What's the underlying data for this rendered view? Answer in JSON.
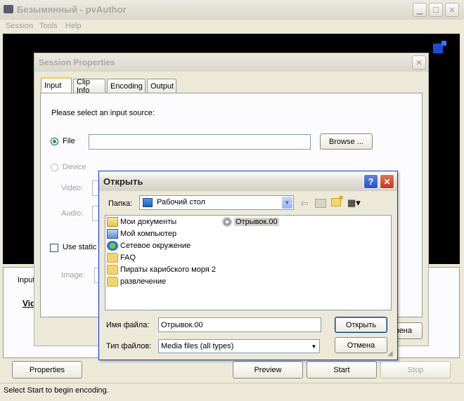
{
  "main_window": {
    "title": "Безымянный - pvAuthor",
    "menu": [
      "Session",
      "Tools",
      "Help"
    ],
    "bottom_tab_partial": "Input",
    "bottom_video_partial": "Vid",
    "buttons": {
      "properties": "Properties",
      "preview": "Preview",
      "start": "Start",
      "stop": "Stop"
    },
    "status": "Select Start to begin encoding."
  },
  "session_dialog": {
    "title": "Session Properties",
    "tabs": [
      "Input",
      "Clip Info",
      "Encoding",
      "Output"
    ],
    "prompt": "Please select an input source:",
    "file_label": "File",
    "browse_label": "Browse ...",
    "device_label": "Device",
    "video_label": "Video:",
    "audio_label": "Audio:",
    "static_image_label": "Use static i",
    "image_label": "Image:",
    "cancel_partial": "мена"
  },
  "open_dialog": {
    "title": "Открыть",
    "folder_label": "Папка:",
    "folder_value": "Рабочий стол",
    "items_col1": [
      "Мои документы",
      "Мой компьютер",
      "Сетевое окружение",
      "FAQ",
      "Пираты карибского моря 2",
      "развлечение"
    ],
    "items_col2": [
      "Отрывок.00"
    ],
    "filename_label": "Имя файла:",
    "filename_value": "Отрывок.00",
    "filetype_label": "Тип файлов:",
    "filetype_value": "Media files (all types)",
    "open_button": "Открыть",
    "cancel_button": "Отмена",
    "help_button": "?",
    "close_button": "✕"
  }
}
